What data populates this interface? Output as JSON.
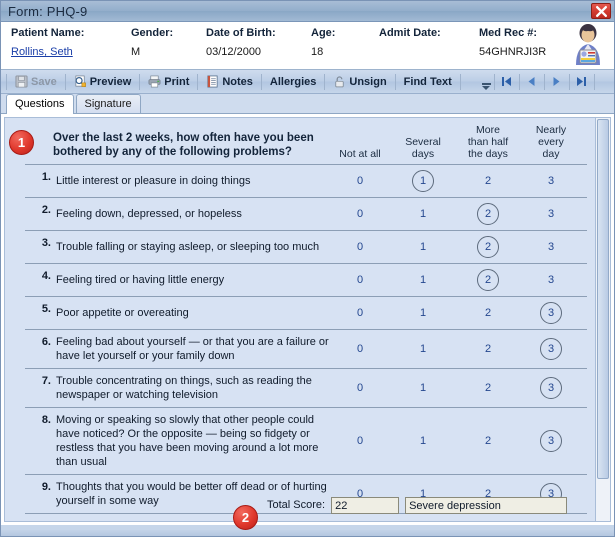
{
  "window": {
    "title": "Form: PHQ-9",
    "close_label": "x",
    "close_icon": "close-icon"
  },
  "patient": {
    "fields": [
      {
        "label": "Patient Name:",
        "value": "Rollins, Seth",
        "is_link": true
      },
      {
        "label": "Gender:",
        "value": "M",
        "is_link": false
      },
      {
        "label": "Date of Birth:",
        "value": "03/12/2000",
        "is_link": false
      },
      {
        "label": "Age:",
        "value": "18",
        "is_link": false
      },
      {
        "label": "Admit Date:",
        "value": "",
        "is_link": false
      },
      {
        "label": "Med Rec #:",
        "value": "54GHNRJI3R",
        "is_link": false
      }
    ],
    "avatar_icon": "patient-avatar-icon"
  },
  "toolbar": {
    "buttons": [
      {
        "label": "Save",
        "icon": "save-disk-icon",
        "disabled": true
      },
      {
        "label": "Preview",
        "icon": "preview-magnifier-icon",
        "disabled": false
      },
      {
        "label": "Print",
        "icon": "printer-icon",
        "disabled": false
      },
      {
        "label": "Notes",
        "icon": "notes-lines-icon",
        "disabled": false
      },
      {
        "label": "Allergies",
        "icon": "",
        "disabled": false
      },
      {
        "label": "Unsign",
        "icon": "padlock-icon",
        "disabled": false
      },
      {
        "label": "Find Text",
        "icon": "",
        "disabled": false
      }
    ],
    "overflow_icon": "toolbar-overflow-icon",
    "nav": [
      {
        "name": "first-record-button",
        "icon": "skip-to-start-icon"
      },
      {
        "name": "previous-record-button",
        "icon": "previous-arrow-icon"
      },
      {
        "name": "next-record-button",
        "icon": "next-arrow-icon"
      },
      {
        "name": "last-record-button",
        "icon": "skip-to-end-icon"
      }
    ]
  },
  "tabs": [
    {
      "label": "Questions",
      "active": true
    },
    {
      "label": "Signature",
      "active": false
    }
  ],
  "form": {
    "badge_one": "1",
    "badge_two": "2",
    "prompt": "Over the last 2 weeks, how often have you been bothered by any of the following problems?",
    "columns": [
      {
        "label": "Not at all",
        "value": "0"
      },
      {
        "label": "Several days",
        "value": "1"
      },
      {
        "label": "More than half the days",
        "value": "2"
      },
      {
        "label": "Nearly every day",
        "value": "3"
      }
    ],
    "column_lines": [
      [
        "Not at all"
      ],
      [
        "Several",
        "days"
      ],
      [
        "More",
        "than half",
        "the days"
      ],
      [
        "Nearly",
        "every",
        "day"
      ]
    ],
    "questions": [
      {
        "number": "1.",
        "text": "Little interest or pleasure in doing things",
        "selected": 1
      },
      {
        "number": "2.",
        "text": "Feeling down, depressed, or hopeless",
        "selected": 2
      },
      {
        "number": "3.",
        "text": "Trouble falling or staying asleep, or sleeping too much",
        "selected": 2
      },
      {
        "number": "4.",
        "text": "Feeling tired or having little energy",
        "selected": 2
      },
      {
        "number": "5.",
        "text": "Poor appetite or overeating",
        "selected": 3
      },
      {
        "number": "6.",
        "text": "Feeling bad about yourself — or that you are a failure or have let yourself or your family down",
        "selected": 3
      },
      {
        "number": "7.",
        "text": "Trouble concentrating on things, such as reading the newspaper or watching television",
        "selected": 3
      },
      {
        "number": "8.",
        "text": "Moving or speaking so slowly that other people could have noticed? Or the opposite —  being so fidgety or restless that you have been moving around a lot more than usual",
        "selected": 3
      },
      {
        "number": "9.",
        "text": "Thoughts that you would be better off dead or of hurting yourself in some way",
        "selected": 3
      }
    ],
    "total_score_label": "Total Score:",
    "total_score_value": "22",
    "severity_value": "Severe depression"
  },
  "colors": {
    "accent_blue": "#24478f",
    "badge_red": "#e0382c",
    "panel_bg": "#d7e2f3",
    "title_bar": "#93aecb",
    "link": "#1a3ea8"
  }
}
